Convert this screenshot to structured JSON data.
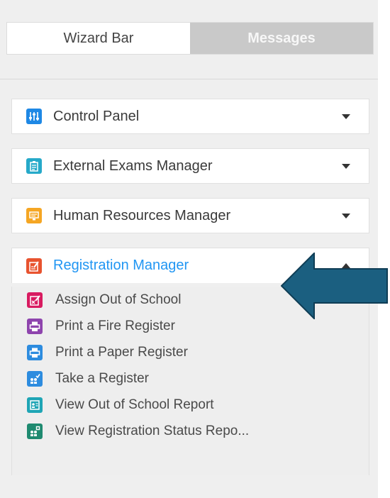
{
  "tabs": {
    "wizard": "Wizard Bar",
    "messages": "Messages"
  },
  "groups": [
    {
      "label": "Control Panel",
      "icon": "sliders-icon",
      "color": "#1e88e5",
      "expanded": false
    },
    {
      "label": "External Exams Manager",
      "icon": "clipboard-icon",
      "color": "#26a9c9",
      "expanded": false
    },
    {
      "label": "Human Resources Manager",
      "icon": "id-card-icon",
      "color": "#f5a623",
      "expanded": false
    },
    {
      "label": "Registration Manager",
      "icon": "register-icon",
      "color": "#e8532f",
      "expanded": true,
      "active_color": "#2196f3"
    }
  ],
  "registration_items": [
    {
      "label": "Assign Out of School",
      "icon": "out-of-school-icon",
      "color": "#d81b60"
    },
    {
      "label": "Print a Fire Register",
      "icon": "printer-icon",
      "color": "#8e44ad"
    },
    {
      "label": "Print a Paper Register",
      "icon": "printer-icon",
      "color": "#2d8cdf"
    },
    {
      "label": "Take a Register",
      "icon": "people-check-icon",
      "color": "#2d8cdf"
    },
    {
      "label": "View Out of School Report",
      "icon": "report-icon",
      "color": "#1fa5b5"
    },
    {
      "label": "View Registration Status Repo...",
      "icon": "people-status-icon",
      "color": "#1f8a70"
    }
  ],
  "annotation": {
    "arrow_color": "#1b5f80"
  }
}
